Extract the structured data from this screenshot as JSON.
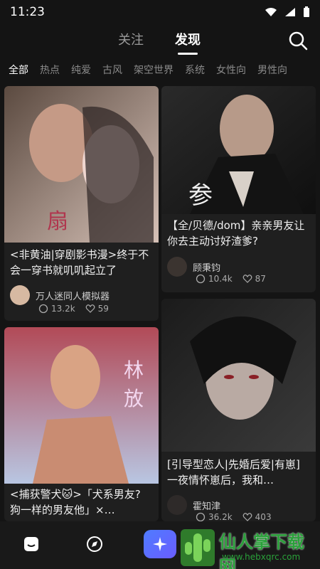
{
  "status": {
    "time": "11:23"
  },
  "top_tabs": {
    "follow": "关注",
    "discover": "发现"
  },
  "categories": [
    "全部",
    "热点",
    "纯爱",
    "古风",
    "架空世界",
    "系统",
    "女性向",
    "男性向"
  ],
  "cards": [
    {
      "title": "<非黄油|穿剧影书漫>终于不会一穿书就叽叽起立了",
      "author": "万人迷同人模拟器",
      "comments": "13.2k",
      "likes": "59"
    },
    {
      "title": "【全/贝德/dom】亲亲男友让你去主动讨好渣爹?",
      "author": "顾秉钧",
      "comments": "10.4k",
      "likes": "87"
    },
    {
      "title": "<捕获警犬🐱>「犬系男友? 狗一样的男友他」×…",
      "author": "",
      "comments": "",
      "likes": ""
    },
    {
      "title": "[引导型恋人|先婚后爱|有崽]一夜情怀崽后，我和…",
      "author": "霍知津",
      "comments": "36.2k",
      "likes": "403"
    }
  ],
  "watermark": {
    "text": "仙人掌下载网",
    "url": "www.hebxqrc.com"
  }
}
